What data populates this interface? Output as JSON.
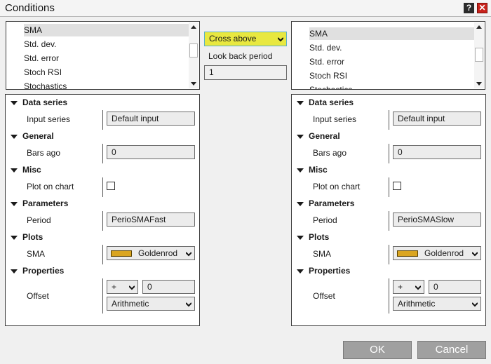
{
  "window": {
    "title": "Conditions",
    "help_label": "?",
    "close_label": "✕"
  },
  "left_indicator_list": {
    "items": [
      {
        "label": "SMA",
        "selected": true
      },
      {
        "label": "Std. dev."
      },
      {
        "label": "Std. error"
      },
      {
        "label": "Stoch RSI"
      },
      {
        "label": "Stochastics"
      }
    ]
  },
  "right_indicator_list": {
    "items": [
      {
        "label": "SMA",
        "selected": true
      },
      {
        "label": "Std. dev."
      },
      {
        "label": "Std. error"
      },
      {
        "label": "Stoch RSI"
      },
      {
        "label": "Stochastics"
      }
    ]
  },
  "condition": {
    "operator": "Cross above",
    "lookback_label": "Look back period",
    "lookback_value": "1"
  },
  "left_properties": {
    "categories": {
      "data_series": "Data series",
      "general": "General",
      "misc": "Misc",
      "parameters": "Parameters",
      "plots": "Plots",
      "properties": "Properties"
    },
    "rows": {
      "input_series_label": "Input series",
      "input_series_value": "Default input",
      "bars_ago_label": "Bars ago",
      "bars_ago_value": "0",
      "plot_on_chart_label": "Plot on chart",
      "plot_on_chart_checked": false,
      "period_label": "Period",
      "period_value": "PerioSMAFast",
      "sma_label": "SMA",
      "sma_color_name": "Goldenrod",
      "sma_color": "#daa520",
      "offset_label": "Offset",
      "offset_sign": "+",
      "offset_value": "0",
      "offset_type": "Arithmetic"
    }
  },
  "right_properties": {
    "categories": {
      "data_series": "Data series",
      "general": "General",
      "misc": "Misc",
      "parameters": "Parameters",
      "plots": "Plots",
      "properties": "Properties"
    },
    "rows": {
      "input_series_label": "Input series",
      "input_series_value": "Default input",
      "bars_ago_label": "Bars ago",
      "bars_ago_value": "0",
      "plot_on_chart_label": "Plot on chart",
      "plot_on_chart_checked": false,
      "period_label": "Period",
      "period_value": "PerioSMASlow",
      "sma_label": "SMA",
      "sma_color_name": "Goldenrod",
      "sma_color": "#daa520",
      "offset_label": "Offset",
      "offset_sign": "+",
      "offset_value": "0",
      "offset_type": "Arithmetic"
    }
  },
  "buttons": {
    "ok_label": "OK",
    "cancel_label": "Cancel"
  },
  "colors": {
    "operator_highlight": "#e8e840",
    "button_bg": "#a0a0a0",
    "close_red": "#c8231c"
  }
}
